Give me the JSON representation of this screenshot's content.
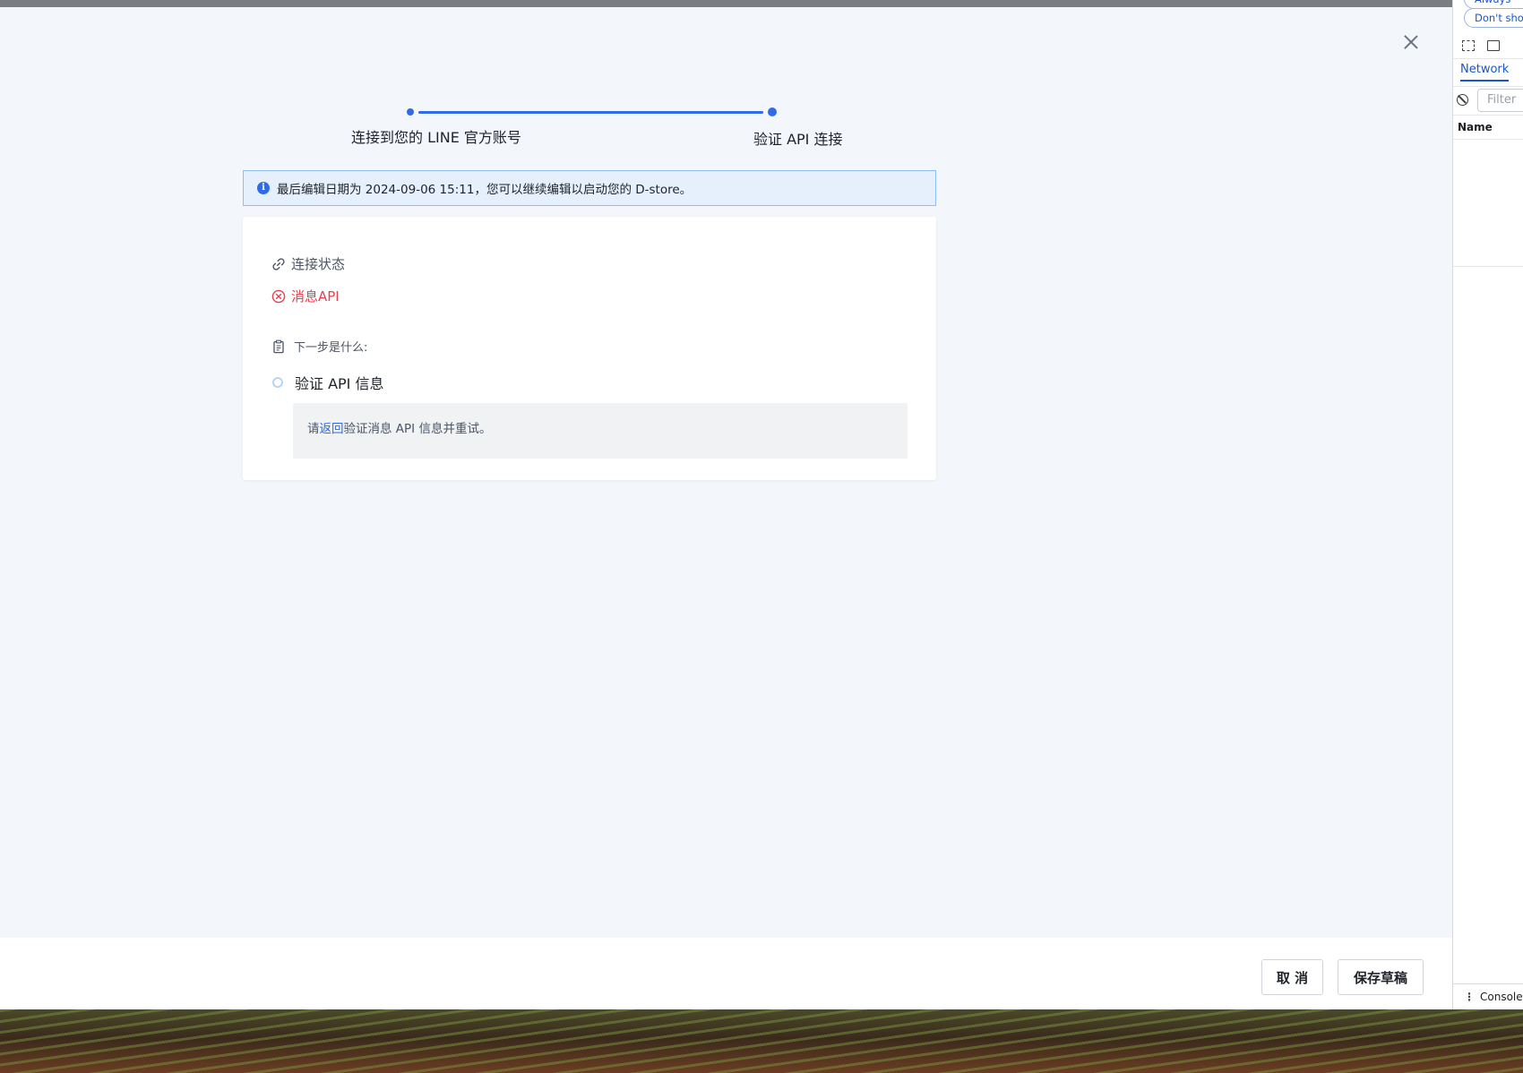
{
  "stepper": {
    "steps": [
      {
        "label": "连接到您的 LINE 官方账号"
      },
      {
        "label": "验证 API 连接"
      }
    ]
  },
  "banner": {
    "icon": "info-icon",
    "text": "最后编辑日期为 2024-09-06 15:11，您可以继续编辑以启动您的 D-store。"
  },
  "card": {
    "status_title": "连接状态",
    "api_error_label": "消息API",
    "next_title": "下一步是什么:",
    "verify_label": "验证 API 信息",
    "hint": {
      "prefix": "请",
      "link": "返回",
      "suffix": "验证消息 API 信息并重试。"
    }
  },
  "footer": {
    "cancel_label": "取 消",
    "save_label": "保存草稿"
  },
  "devtools": {
    "pill_1": "Always",
    "pill_2": "Don't show",
    "tab_network": "Network",
    "filter_placeholder": "Filter",
    "column_name": "Name",
    "console_label": "Console"
  },
  "colors": {
    "accent": "#2f6ae8",
    "error": "#e5404f",
    "page_bg": "#f3f6fa",
    "banner_bg": "#e5f0fc"
  }
}
